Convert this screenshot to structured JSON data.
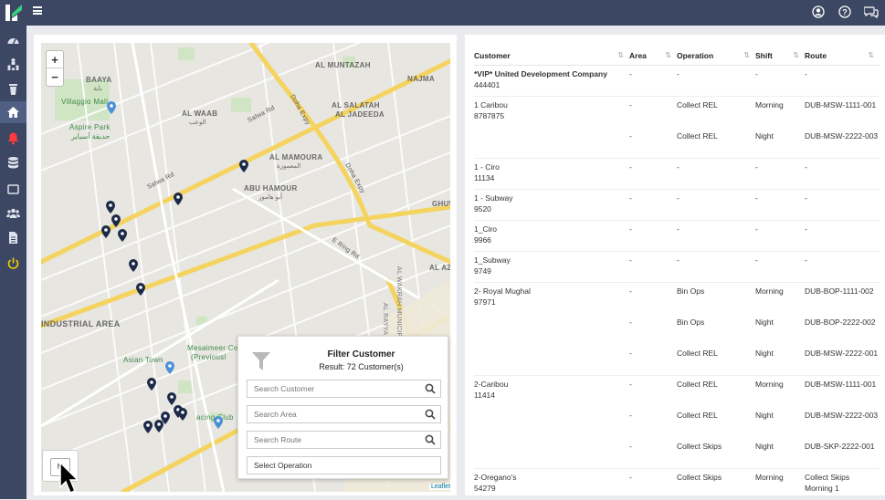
{
  "app": {
    "menu_icon": "hamburger-icon",
    "logo_icon": "app-logo-icon",
    "top_icons": [
      "user-circle-icon",
      "help-icon",
      "chat-icon"
    ],
    "colors": {
      "topbar": "#3c4763",
      "sidebar": "#3c4763",
      "accent_red": "#ff3b3b",
      "accent_yellow": "#f5d000",
      "pin": "#1c2a4a"
    }
  },
  "sidebar": {
    "icons": [
      "dashboard-icon",
      "users-tree-icon",
      "trash-icon",
      "home-icon",
      "bell-icon",
      "database-icon",
      "tablet-icon",
      "group-icon",
      "document-icon",
      "power-icon"
    ]
  },
  "map": {
    "zoom_in": "+",
    "zoom_out": "−",
    "attribution": "Leaflet",
    "layer_button": "M",
    "labels": {
      "baaya": "BAAYA",
      "baaya_ar": "باية",
      "villaggio": "Villaggio Mall",
      "aspire": "Aspire Park",
      "aspire_ar": "حديقة أسباير",
      "al_waab": "AL WAAB",
      "al_waab_ar": "الوعب",
      "al_muntazah": "AL MUNTAZAH",
      "najma": "NAJMA",
      "al_salatah": "AL SALATAH",
      "al_jadeeda": "AL JADEEDA",
      "al_mamoura": "AL MAMOURA",
      "al_mamoura_ar": "المعمورة",
      "abu_hamour": "ABU HAMOUR",
      "abu_hamour_ar": "أبو هامور",
      "industrial": "INDUSTRIAL AREA",
      "asian_town": "Asian Town",
      "mesaimeer": "Mesaimeer Ce",
      "previously": "(Previousl",
      "racing": "acing Club",
      "salwa_rd": "Salwa Rd",
      "salwa_rd2": "Salwa Rd",
      "doha_expy": "Doha Expy",
      "doha_expy2": "Doha Expy",
      "e_ring": "E Ring Rd",
      "al_rayyan": "AL RAYYAN MUNICIPALITY",
      "al_wakrah": "AL WAKRAH MUNICIPALI",
      "ghuw": "GHUW",
      "al_aziziya": "AL AZIZ"
    }
  },
  "filter": {
    "title": "Filter Customer",
    "result": "Result: 72 Customer(s)",
    "search_customer": "Search Customer",
    "search_area": "Search Area",
    "search_route": "Search Route",
    "select_operation": "Select Operation"
  },
  "table": {
    "headers": {
      "customer": "Customer",
      "area": "Area",
      "operation": "Operation",
      "shift": "Shift",
      "route": "Route"
    },
    "sort_icon": "sort-icon",
    "rows": [
      {
        "name": "*VIP* United Development Company",
        "code": "444401",
        "lines": [
          {
            "area": "-",
            "op": "-",
            "shift": "-",
            "route": "-"
          }
        ]
      },
      {
        "name": "1 Caribou",
        "code": "8787875",
        "lines": [
          {
            "area": "-",
            "op": "Collect REL",
            "shift": "Morning",
            "route": "DUB-MSW-1111-001"
          },
          {
            "area": "-",
            "op": "Collect REL",
            "shift": "Night",
            "route": "DUB-MSW-2222-003"
          }
        ]
      },
      {
        "name": "1 - Ciro",
        "code": "11134",
        "lines": [
          {
            "area": "-",
            "op": "-",
            "shift": "-",
            "route": "-"
          }
        ]
      },
      {
        "name": "1 - Subway",
        "code": "9520",
        "lines": [
          {
            "area": "-",
            "op": "-",
            "shift": "-",
            "route": "-"
          }
        ]
      },
      {
        "name": "1_Ciro",
        "code": "9966",
        "lines": [
          {
            "area": "-",
            "op": "-",
            "shift": "-",
            "route": "-"
          }
        ]
      },
      {
        "name": "1_Subway",
        "code": "9749",
        "lines": [
          {
            "area": "-",
            "op": "-",
            "shift": "-",
            "route": "-"
          }
        ]
      },
      {
        "name": "2- Royal Mughal",
        "code": "97971",
        "lines": [
          {
            "area": "-",
            "op": "Bin Ops",
            "shift": "Morning",
            "route": "DUB-BOP-1111-002"
          },
          {
            "area": "-",
            "op": "Bin Ops",
            "shift": "Night",
            "route": "DUB-BOP-2222-002"
          },
          {
            "area": "-",
            "op": "Collect REL",
            "shift": "Night",
            "route": "DUB-MSW-2222-001"
          }
        ]
      },
      {
        "name": "2-Caribou",
        "code": "11414",
        "lines": [
          {
            "area": "-",
            "op": "Collect REL",
            "shift": "Morning",
            "route": "DUB-MSW-1111-001"
          },
          {
            "area": "-",
            "op": "Collect REL",
            "shift": "Night",
            "route": "DUB-MSW-2222-003"
          },
          {
            "area": "-",
            "op": "Collect Skips",
            "shift": "Night",
            "route": "DUB-SKP-2222-001"
          }
        ]
      },
      {
        "name": "2-Oregano's",
        "code": "54279",
        "lines": [
          {
            "area": "-",
            "op": "Collect Skips",
            "shift": "Morning",
            "route": "Collect Skips Morning 1"
          }
        ]
      }
    ]
  }
}
